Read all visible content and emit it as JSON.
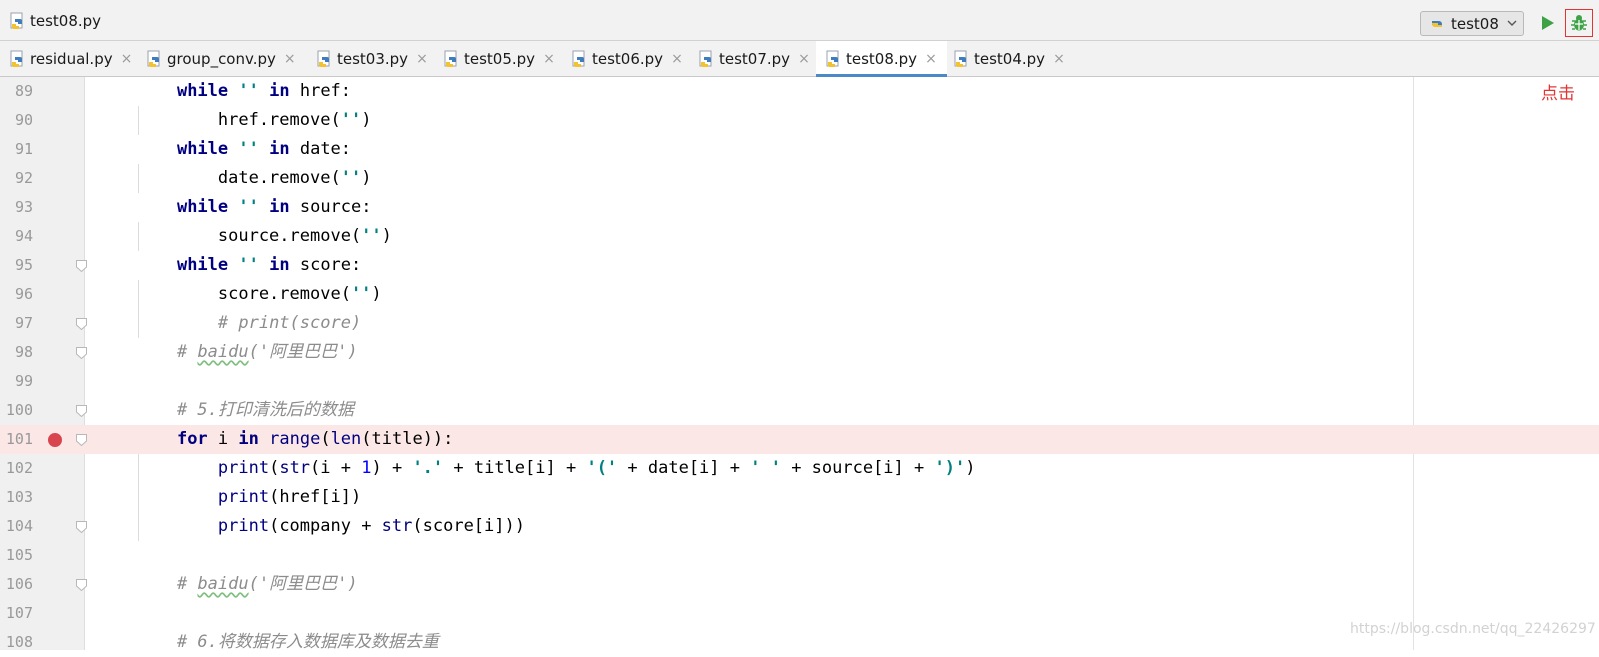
{
  "nav": {
    "file_name": "test08.py"
  },
  "run": {
    "config_name": "test08"
  },
  "tabs": [
    {
      "label": "residual.py",
      "close": "×"
    },
    {
      "label": "group_conv.py",
      "close": "×"
    },
    {
      "label": "test03.py",
      "close": "×"
    },
    {
      "label": "test05.py",
      "close": "×"
    },
    {
      "label": "test06.py",
      "close": "×"
    },
    {
      "label": "test07.py",
      "close": "×"
    },
    {
      "label": "test08.py",
      "close": "×"
    },
    {
      "label": "test04.py",
      "close": "×"
    }
  ],
  "active_tab": "test08.py",
  "annotation": "点击",
  "watermark": "https://blog.csdn.net/qq_22426297",
  "colors": {
    "accent": "#4a88c7",
    "breakpoint": "#d8454e",
    "annotation": "#e53333",
    "run": "#3da145"
  },
  "icons": [
    "python-file-icon",
    "chevron-down-icon",
    "run-icon",
    "debug-bug-icon",
    "close-icon",
    "breakpoint-icon",
    "fold-icon"
  ],
  "editor": {
    "lines": [
      {
        "n": "89",
        "tokens": [
          {
            "t": "    "
          },
          {
            "t": "while",
            "c": "kw"
          },
          {
            "t": " "
          },
          {
            "t": "''",
            "c": "str"
          },
          {
            "t": " "
          },
          {
            "t": "in",
            "c": "kw"
          },
          {
            "t": " href:"
          }
        ]
      },
      {
        "n": "90",
        "guide": true,
        "tokens": [
          {
            "t": "        href.remove("
          },
          {
            "t": "''",
            "c": "str"
          },
          {
            "t": ")"
          }
        ]
      },
      {
        "n": "91",
        "tokens": [
          {
            "t": "    "
          },
          {
            "t": "while",
            "c": "kw"
          },
          {
            "t": " "
          },
          {
            "t": "''",
            "c": "str"
          },
          {
            "t": " "
          },
          {
            "t": "in",
            "c": "kw"
          },
          {
            "t": " date:"
          }
        ]
      },
      {
        "n": "92",
        "guide": true,
        "tokens": [
          {
            "t": "        date.remove("
          },
          {
            "t": "''",
            "c": "str"
          },
          {
            "t": ")"
          }
        ]
      },
      {
        "n": "93",
        "tokens": [
          {
            "t": "    "
          },
          {
            "t": "while",
            "c": "kw"
          },
          {
            "t": " "
          },
          {
            "t": "''",
            "c": "str"
          },
          {
            "t": " "
          },
          {
            "t": "in",
            "c": "kw"
          },
          {
            "t": " source:"
          }
        ]
      },
      {
        "n": "94",
        "guide": true,
        "tokens": [
          {
            "t": "        source.remove("
          },
          {
            "t": "''",
            "c": "str"
          },
          {
            "t": ")"
          }
        ]
      },
      {
        "n": "95",
        "fold": true,
        "tokens": [
          {
            "t": "    "
          },
          {
            "t": "while",
            "c": "kw"
          },
          {
            "t": " "
          },
          {
            "t": "''",
            "c": "str"
          },
          {
            "t": " "
          },
          {
            "t": "in",
            "c": "kw"
          },
          {
            "t": " score:"
          }
        ]
      },
      {
        "n": "96",
        "guide": true,
        "tokens": [
          {
            "t": "        score.remove("
          },
          {
            "t": "''",
            "c": "str"
          },
          {
            "t": ")"
          }
        ]
      },
      {
        "n": "97",
        "guide": true,
        "fold": true,
        "tokens": [
          {
            "t": "        "
          },
          {
            "t": "# print(score)",
            "c": "cm"
          }
        ]
      },
      {
        "n": "98",
        "fold": true,
        "tokens": [
          {
            "t": "    "
          },
          {
            "t": "# ",
            "c": "cm"
          },
          {
            "t": "baidu",
            "c": "cm squig"
          },
          {
            "t": "('阿里巴巴')",
            "c": "cm"
          }
        ]
      },
      {
        "n": "99",
        "tokens": []
      },
      {
        "n": "100",
        "fold": true,
        "tokens": [
          {
            "t": "    "
          },
          {
            "t": "# 5.打印清洗后的数据",
            "c": "cm"
          }
        ]
      },
      {
        "n": "101",
        "breakpoint": true,
        "fold": true,
        "tokens": [
          {
            "t": "    "
          },
          {
            "t": "for",
            "c": "kw"
          },
          {
            "t": " i "
          },
          {
            "t": "in",
            "c": "kw"
          },
          {
            "t": " "
          },
          {
            "t": "range",
            "c": "bi"
          },
          {
            "t": "("
          },
          {
            "t": "len",
            "c": "bi"
          },
          {
            "t": "(title)):"
          }
        ]
      },
      {
        "n": "102",
        "guide": true,
        "tokens": [
          {
            "t": "        "
          },
          {
            "t": "print",
            "c": "bi"
          },
          {
            "t": "("
          },
          {
            "t": "str",
            "c": "bi"
          },
          {
            "t": "(i + "
          },
          {
            "t": "1",
            "c": "num"
          },
          {
            "t": ") + "
          },
          {
            "t": "'.'",
            "c": "str"
          },
          {
            "t": " + title[i] + "
          },
          {
            "t": "'('",
            "c": "str"
          },
          {
            "t": " + date[i] + "
          },
          {
            "t": "' '",
            "c": "str"
          },
          {
            "t": " + source[i] + "
          },
          {
            "t": "')'",
            "c": "str"
          },
          {
            "t": ")"
          }
        ]
      },
      {
        "n": "103",
        "guide": true,
        "tokens": [
          {
            "t": "        "
          },
          {
            "t": "print",
            "c": "bi"
          },
          {
            "t": "(href[i])"
          }
        ]
      },
      {
        "n": "104",
        "guide": true,
        "fold": true,
        "tokens": [
          {
            "t": "        "
          },
          {
            "t": "print",
            "c": "bi"
          },
          {
            "t": "(company + "
          },
          {
            "t": "str",
            "c": "bi"
          },
          {
            "t": "(score[i]))"
          }
        ]
      },
      {
        "n": "105",
        "tokens": []
      },
      {
        "n": "106",
        "fold": true,
        "tokens": [
          {
            "t": "    "
          },
          {
            "t": "# ",
            "c": "cm"
          },
          {
            "t": "baidu",
            "c": "cm squig"
          },
          {
            "t": "('阿里巴巴')",
            "c": "cm"
          }
        ]
      },
      {
        "n": "107",
        "tokens": []
      },
      {
        "n": "108",
        "tokens": [
          {
            "t": "    "
          },
          {
            "t": "# 6.将数据存入数据库及数据去重",
            "c": "cm"
          }
        ]
      }
    ]
  }
}
